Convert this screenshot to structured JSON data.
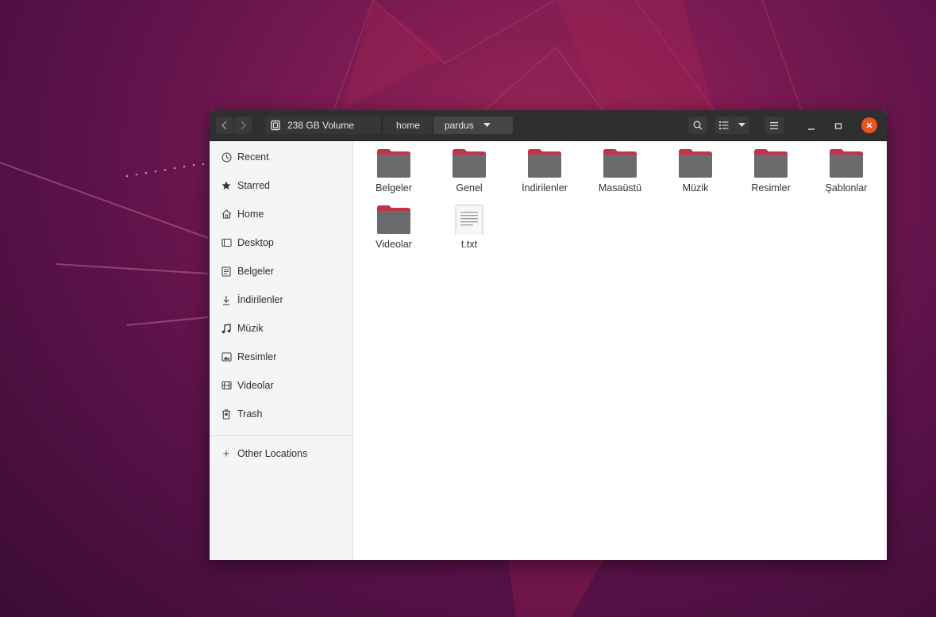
{
  "toolbar": {
    "location_button": "238 GB Volume",
    "breadcrumbs": [
      "home",
      "pardus"
    ]
  },
  "sidebar": {
    "items": [
      {
        "label": "Recent",
        "icon": "clock-icon"
      },
      {
        "label": "Starred",
        "icon": "star-icon"
      },
      {
        "label": "Home",
        "icon": "home-icon"
      },
      {
        "label": "Desktop",
        "icon": "desktop-icon"
      },
      {
        "label": "Belgeler",
        "icon": "document-icon"
      },
      {
        "label": "İndirilenler",
        "icon": "download-icon"
      },
      {
        "label": "Müzik",
        "icon": "music-icon"
      },
      {
        "label": "Resimler",
        "icon": "picture-icon"
      },
      {
        "label": "Videolar",
        "icon": "video-icon"
      },
      {
        "label": "Trash",
        "icon": "trash-icon"
      }
    ],
    "other_locations": "Other Locations"
  },
  "files": [
    {
      "name": "Belgeler",
      "type": "folder"
    },
    {
      "name": "Genel",
      "type": "folder"
    },
    {
      "name": "İndirilenler",
      "type": "folder"
    },
    {
      "name": "Masaüstü",
      "type": "folder"
    },
    {
      "name": "Müzik",
      "type": "folder"
    },
    {
      "name": "Resimler",
      "type": "folder"
    },
    {
      "name": "Şablonlar",
      "type": "folder"
    },
    {
      "name": "Videolar",
      "type": "folder"
    },
    {
      "name": "t.txt",
      "type": "text-file"
    }
  ],
  "colors": {
    "accent_close": "#e95420",
    "folder_top": "#c0344a",
    "folder_body": "#6b6b6b",
    "headerbar": "#2f2f2f"
  }
}
